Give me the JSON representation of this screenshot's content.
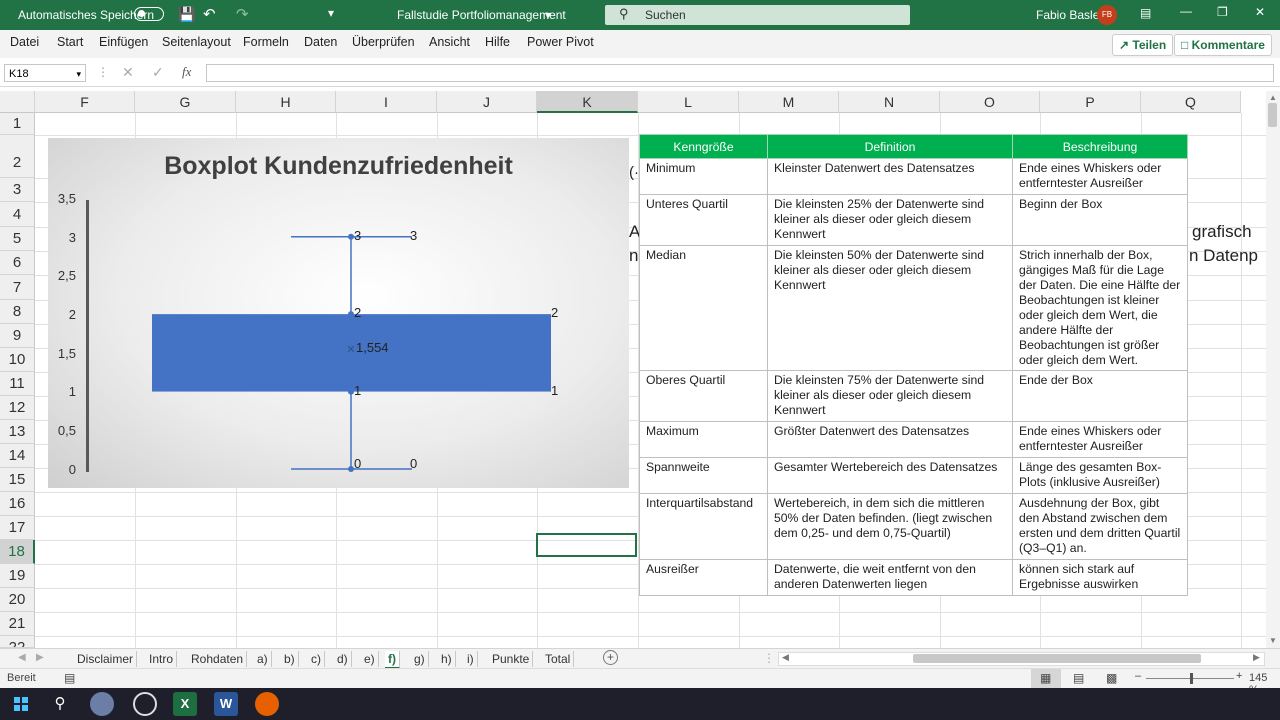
{
  "titlebar": {
    "autosave_label": "Automatisches Speichern",
    "doc_title": "Fallstudie Portfoliomanagement",
    "search_placeholder": "Suchen",
    "user_name": "Fabio Basler",
    "user_initials": "FB",
    "accent": "#217346"
  },
  "menu": {
    "items": [
      "Datei",
      "Start",
      "Einfügen",
      "Seitenlayout",
      "Formeln",
      "Daten",
      "Überprüfen",
      "Ansicht",
      "Hilfe",
      "Power Pivot"
    ],
    "share_label": "Teilen",
    "comments_label": "Kommentare"
  },
  "formula": {
    "name_box": "K18",
    "fx": "fx",
    "value": ""
  },
  "grid": {
    "columns": [
      "F",
      "G",
      "H",
      "I",
      "J",
      "K",
      "L",
      "M",
      "N",
      "O",
      "P",
      "Q"
    ],
    "selected_column": "K",
    "rows": [
      "1",
      "2",
      "3",
      "4",
      "5",
      "6",
      "7",
      "8",
      "9",
      "10",
      "11",
      "12",
      "13",
      "14",
      "15",
      "16",
      "17",
      "18",
      "19",
      "20",
      "21",
      "22"
    ],
    "selected_row": "18",
    "clipped_texts": [
      "(·",
      "A",
      "n",
      "grafisch",
      "n Datenp"
    ]
  },
  "chart": {
    "title": "Boxplot Kundenzufriedenheit",
    "y_ticks": [
      "3,5",
      "3",
      "2,5",
      "2",
      "1,5",
      "1",
      "0,5",
      "0"
    ],
    "colors": {
      "box": "#4472c4",
      "whisker": "#4472c4"
    }
  },
  "chart_data": {
    "type": "boxplot",
    "title": "Boxplot Kundenzufriedenheit",
    "ylim": [
      0,
      3.5
    ],
    "min": 0,
    "q1": 1,
    "median": 1,
    "mean": 1.554,
    "q3": 2,
    "max": 3,
    "data_labels": {
      "max": [
        "3",
        "3"
      ],
      "q3": [
        "2",
        "2"
      ],
      "mean": "1,554",
      "q1": [
        "1",
        "1"
      ],
      "min": [
        "0",
        "0"
      ]
    }
  },
  "info_table": {
    "headers": [
      "Kenngröße",
      "Definition",
      "Beschreibung"
    ],
    "header_color": "#00b050",
    "rows": [
      [
        "Minimum",
        "Kleinster Datenwert des Datensatzes",
        "Ende eines Whiskers oder entferntester Ausreißer"
      ],
      [
        "Unteres Quartil",
        "Die kleinsten 25% der Datenwerte sind kleiner als dieser oder gleich diesem Kennwert",
        "Beginn der Box"
      ],
      [
        "Median",
        "Die kleinsten 50% der Datenwerte sind kleiner als dieser oder gleich diesem Kennwert",
        "Strich innerhalb der Box, gängiges Maß für die Lage der Daten. Die eine Hälfte der Beobachtungen ist kleiner oder gleich dem Wert, die andere Hälfte der Beobachtungen ist größer oder gleich dem Wert."
      ],
      [
        "Oberes Quartil",
        "Die kleinsten 75% der Datenwerte sind kleiner als dieser oder gleich diesem Kennwert",
        "Ende der Box"
      ],
      [
        "Maximum",
        "Größter Datenwert des Datensatzes",
        "Ende eines Whiskers oder entferntester Ausreißer"
      ],
      [
        "Spannweite",
        "Gesamter Wertebereich des Datensatzes",
        "Länge des gesamten Box-Plots (inklusive Ausreißer)"
      ],
      [
        "Interquartilsabstand",
        "Wertebereich, in dem sich die mittleren 50% der Daten befinden. (liegt zwischen dem 0,25- und dem 0,75-Quartil)",
        "Ausdehnung der Box, gibt den Abstand zwischen dem ersten und dem dritten Quartil (Q3–Q1) an."
      ],
      [
        "Ausreißer",
        "Datenwerte, die weit entfernt von den anderen Datenwerten liegen",
        "können sich stark auf Ergebnisse auswirken"
      ]
    ]
  },
  "sheets": {
    "tabs": [
      "Disclaimer",
      "Intro",
      "Rohdaten",
      "a)",
      "b)",
      "c)",
      "d)",
      "e)",
      "f)",
      "g)",
      "h)",
      "i)",
      "Punkte",
      "Total"
    ],
    "active": "f)"
  },
  "status": {
    "mode": "Bereit",
    "zoom": "145 %"
  },
  "taskbar": {
    "apps": [
      "windows-start",
      "search",
      "copilot",
      "obs",
      "excel",
      "word",
      "firefox"
    ]
  }
}
